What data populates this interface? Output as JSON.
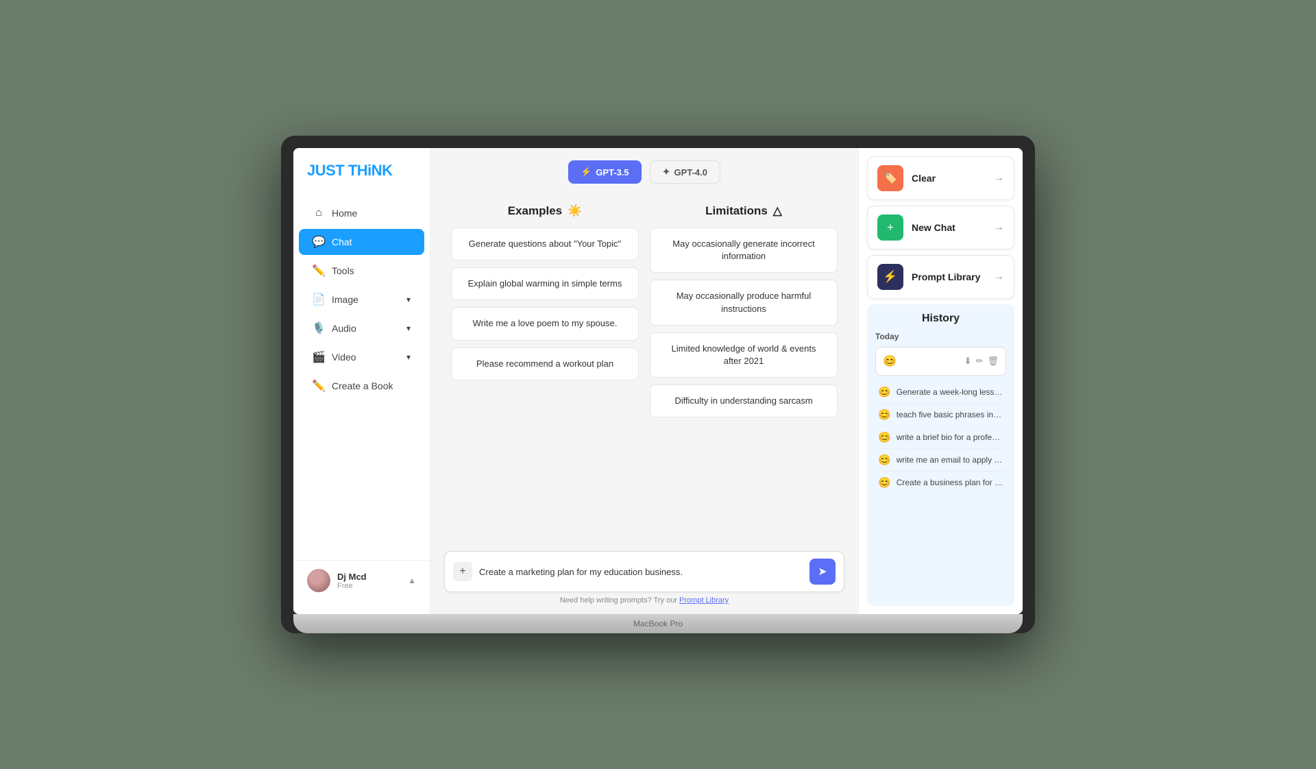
{
  "app": {
    "logo": "JUST THiNK",
    "macbook_label": "MacBook Pro"
  },
  "sidebar": {
    "nav_items": [
      {
        "id": "home",
        "label": "Home",
        "icon": "⌂",
        "active": false
      },
      {
        "id": "chat",
        "label": "Chat",
        "icon": "💬",
        "active": true
      },
      {
        "id": "tools",
        "label": "Tools",
        "icon": "✏️",
        "active": false
      },
      {
        "id": "image",
        "label": "Image",
        "icon": "📄",
        "active": false,
        "has_arrow": true
      },
      {
        "id": "audio",
        "label": "Audio",
        "icon": "🎙️",
        "active": false,
        "has_arrow": true
      },
      {
        "id": "video",
        "label": "Video",
        "icon": "🎬",
        "active": false,
        "has_arrow": true
      },
      {
        "id": "create-book",
        "label": "Create a Book",
        "icon": "✏️",
        "active": false
      }
    ],
    "user": {
      "name": "Dj Mcd",
      "plan": "Free"
    }
  },
  "model_selector": {
    "gpt35": {
      "label": "GPT-3.5",
      "icon": "⚡",
      "active": true
    },
    "gpt4": {
      "label": "GPT-4.0",
      "icon": "✦",
      "active": false
    }
  },
  "examples": {
    "title": "Examples",
    "icon": "☀️",
    "items": [
      "Generate questions about \"Your Topic\"",
      "Explain global warming in simple terms",
      "Write me a love poem to my spouse.",
      "Please recommend a workout plan"
    ]
  },
  "limitations": {
    "title": "Limitations",
    "icon": "△",
    "items": [
      "May occasionally generate incorrect information",
      "May occasionally produce harmful instructions",
      "Limited knowledge of world & events after 2021",
      "Difficulty in understanding sarcasm"
    ]
  },
  "chat_input": {
    "placeholder": "Create a marketing plan for my education business.",
    "value": "Create a marketing plan for my education business.",
    "attach_icon": "+",
    "send_icon": "➤"
  },
  "help_text": {
    "prefix": "Need help writing prompts? Try our ",
    "link_label": "Prompt Library"
  },
  "right_panel": {
    "actions": [
      {
        "id": "clear",
        "label": "Clear",
        "icon": "🏷️",
        "color_class": "clear"
      },
      {
        "id": "new-chat",
        "label": "New Chat",
        "icon": "+",
        "color_class": "new-chat"
      },
      {
        "id": "prompt-library",
        "label": "Prompt Library",
        "icon": "⚡",
        "color_class": "prompt"
      }
    ],
    "history": {
      "title": "History",
      "today_label": "Today",
      "active_item_icon": "😊",
      "items": [
        {
          "text": "Generate a week-long lesson pla..."
        },
        {
          "text": "teach five basic phrases in Spanish"
        },
        {
          "text": "write a brief bio for a professional ..."
        },
        {
          "text": "write me an email to apply for a jo..."
        },
        {
          "text": "Create a business plan for a mark..."
        }
      ]
    }
  }
}
